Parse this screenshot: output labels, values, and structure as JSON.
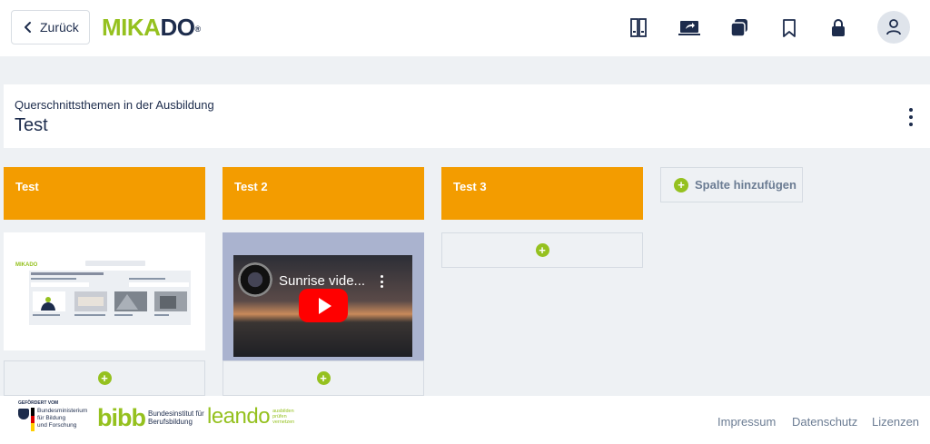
{
  "header": {
    "back_label": "Zurück",
    "logo_green": "MIKA",
    "logo_dark": "DO",
    "logo_mark": "®",
    "icons": [
      "books-icon",
      "screen-share-icon",
      "stack-icon",
      "bookmark-icon",
      "lock-icon",
      "user-icon"
    ]
  },
  "board": {
    "subtitle": "Querschnittsthemen in der Ausbildung",
    "title": "Test"
  },
  "columns": [
    {
      "label": "Test"
    },
    {
      "label": "Test 2"
    },
    {
      "label": "Test 3"
    }
  ],
  "cards": {
    "video_title": "Sunrise vide..."
  },
  "add_column_label": "Spalte hinzufügen",
  "footer": {
    "funded_by": "GEFÖRDERT VOM",
    "ministry_line1": "Bundesministerium",
    "ministry_line2": "für Bildung",
    "ministry_line3": "und Forschung",
    "bibb_word": "bibb",
    "bibb_line1": "Bundesinstitut für",
    "bibb_line2": "Berufsbildung",
    "leando_word": "leando",
    "leando_line1": "ausbilden",
    "leando_line2": "prüfen",
    "leando_line3": "vernetzen",
    "links": [
      "Impressum",
      "Datenschutz",
      "Lizenzen"
    ]
  },
  "colors": {
    "brand_green": "#95c11f",
    "brand_dark": "#1d2c4c",
    "column_orange": "#f39c00",
    "background": "#eef1f4"
  }
}
